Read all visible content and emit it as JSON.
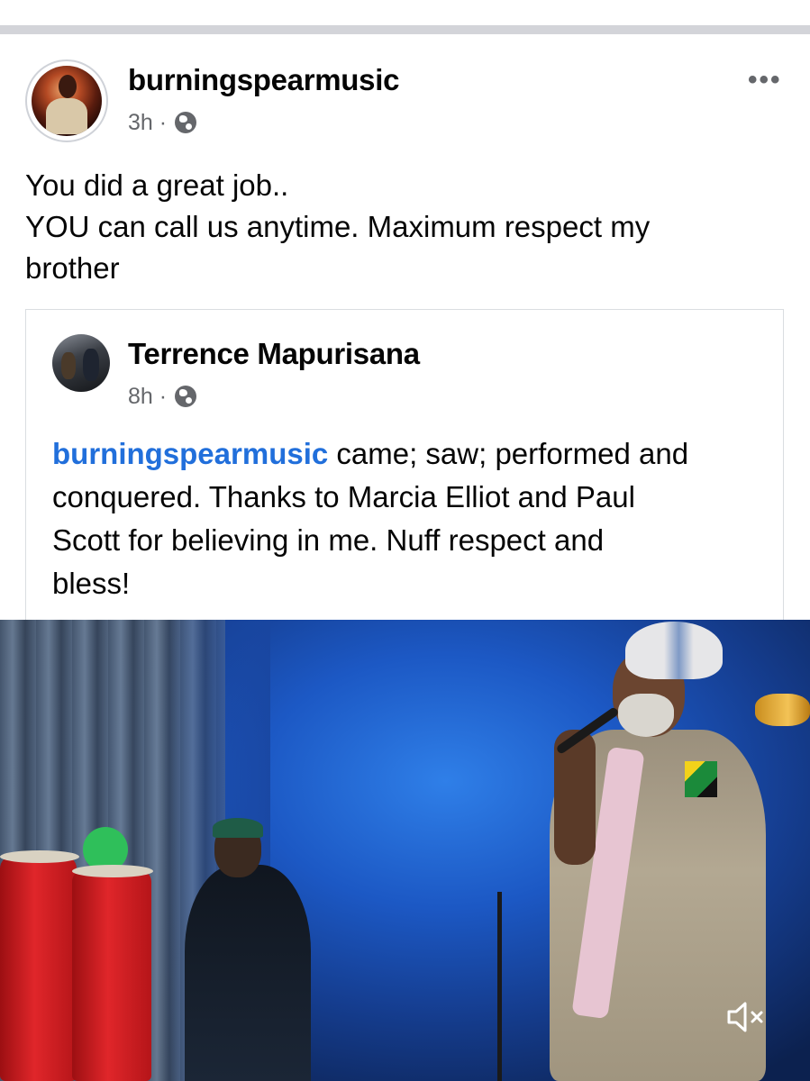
{
  "post": {
    "author": "burningspearmusic",
    "time": "3h",
    "separator": "·",
    "privacy_icon": "globe-icon",
    "more_icon": "more-options-icon",
    "more_label": "•••",
    "text_lines": [
      "You did a great job..",
      "YOU can call us anytime. Maximum respect my",
      "brother"
    ]
  },
  "shared_post": {
    "author": "Terrence Mapurisana",
    "time": "8h",
    "separator": "·",
    "privacy_icon": "globe-icon",
    "mention": "burningspearmusic",
    "line1_rest": " came; saw; performed and",
    "text_lines": [
      "conquered. Thanks to Marcia Elliot and Paul",
      "Scott for believing in me. Nuff respect and",
      "bless!"
    ]
  },
  "video": {
    "mute_icon": "muted-speaker-icon"
  },
  "colors": {
    "link": "#216fdb",
    "meta": "#65676b",
    "divider": "#d3d4d9"
  }
}
